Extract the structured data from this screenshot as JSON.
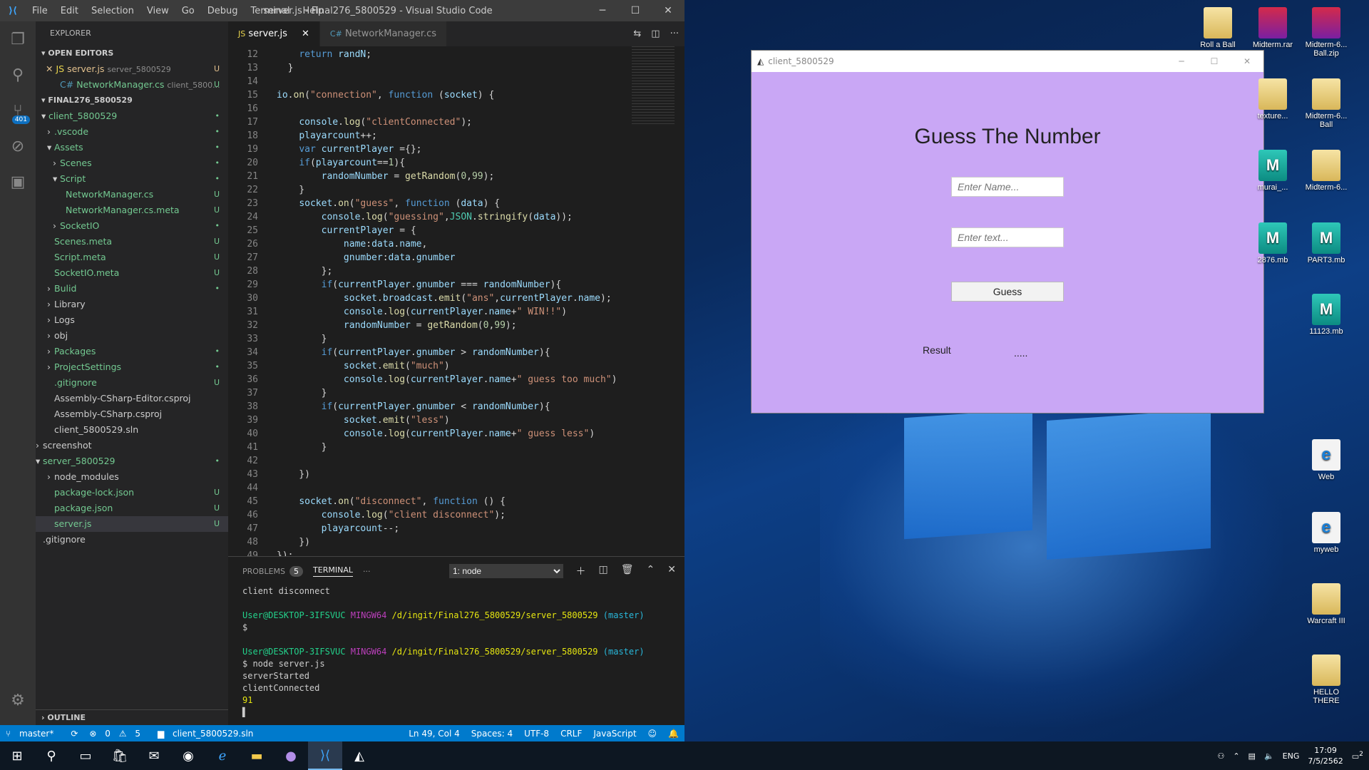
{
  "vscode": {
    "menu": [
      "File",
      "Edit",
      "Selection",
      "View",
      "Go",
      "Debug",
      "Terminal",
      "Help"
    ],
    "title": "server.js - Final276_5800529 - Visual Studio Code",
    "scm_badge": "401",
    "explorer_header": "EXPLORER",
    "open_editors_label": "OPEN EDITORS",
    "open_editors": [
      {
        "name": "server.js",
        "desc": "server_5800529",
        "status": "U",
        "icon": "JS"
      },
      {
        "name": "NetworkManager.cs",
        "desc": "client_5800...",
        "status": "U",
        "icon": "C#"
      }
    ],
    "workspace_label": "FINAL276_5800529",
    "tree": [
      {
        "name": "client_5800529",
        "status": "•"
      },
      {
        "name": ".vscode",
        "status": "•"
      },
      {
        "name": "Assets",
        "status": "•"
      },
      {
        "name": "Scenes",
        "status": "•"
      },
      {
        "name": "Script",
        "status": "•"
      },
      {
        "name": "NetworkManager.cs",
        "status": "U"
      },
      {
        "name": "NetworkManager.cs.meta",
        "status": "U"
      },
      {
        "name": "SocketIO",
        "status": "•"
      },
      {
        "name": "Scenes.meta",
        "status": "U"
      },
      {
        "name": "Script.meta",
        "status": "U"
      },
      {
        "name": "SocketIO.meta",
        "status": "U"
      },
      {
        "name": "Bulid",
        "status": "•"
      },
      {
        "name": "Library",
        "status": ""
      },
      {
        "name": "Logs",
        "status": ""
      },
      {
        "name": "obj",
        "status": ""
      },
      {
        "name": "Packages",
        "status": "•"
      },
      {
        "name": "ProjectSettings",
        "status": "•"
      },
      {
        "name": ".gitignore",
        "status": "U"
      },
      {
        "name": "Assembly-CSharp-Editor.csproj",
        "status": ""
      },
      {
        "name": "Assembly-CSharp.csproj",
        "status": ""
      },
      {
        "name": "client_5800529.sln",
        "status": ""
      },
      {
        "name": "screenshot",
        "status": ""
      },
      {
        "name": "server_5800529",
        "status": "•"
      },
      {
        "name": "node_modules",
        "status": ""
      },
      {
        "name": "package-lock.json",
        "status": "U"
      },
      {
        "name": "package.json",
        "status": "U"
      },
      {
        "name": "server.js",
        "status": "U"
      },
      {
        "name": ".gitignore",
        "status": ""
      }
    ],
    "outline_label": "OUTLINE",
    "tabs": [
      "server.js",
      "NetworkManager.cs"
    ],
    "code_lines": [
      "12",
      "13",
      "14",
      "15",
      "16",
      "17",
      "18",
      "19",
      "20",
      "21",
      "22",
      "23",
      "24",
      "25",
      "26",
      "27",
      "28",
      "29",
      "30",
      "31",
      "32",
      "33",
      "34",
      "35",
      "36",
      "37",
      "38",
      "39",
      "40",
      "41",
      "42",
      "43",
      "44",
      "45",
      "46",
      "47",
      "48",
      "49"
    ],
    "panel": {
      "problems_label": "PROBLEMS",
      "problems_count": "5",
      "terminal_label": "TERMINAL",
      "more": "···",
      "terminal_select": "1: node",
      "lines": [
        "client disconnect",
        "",
        "User@DESKTOP-3IFSVUC MINGW64 /d/ingit/Final276_5800529/server_5800529 (master)",
        "$",
        "",
        "User@DESKTOP-3IFSVUC MINGW64 /d/ingit/Final276_5800529/server_5800529 (master)",
        "$ node server.js",
        "serverStarted",
        "clientConnected",
        "91"
      ]
    },
    "status": {
      "branch": "master*",
      "errors": "0",
      "warnings": "5",
      "solution": "client_5800529.sln",
      "position": "Ln 49, Col 4",
      "spaces": "Spaces: 4",
      "encoding": "UTF-8",
      "eol": "CRLF",
      "language": "JavaScript"
    }
  },
  "client": {
    "window_title": "client_5800529",
    "heading": "Guess The Number",
    "name_placeholder": "Enter Name...",
    "text_placeholder": "Enter text...",
    "guess_button": "Guess",
    "result_label": "Result",
    "result_value": "....."
  },
  "desktop_icons": [
    {
      "label": "Roll a Ball",
      "kind": "folder"
    },
    {
      "label": "Midterm.rar",
      "kind": "rar"
    },
    {
      "label": "Midterm-6... Ball.zip",
      "kind": "rar"
    },
    {
      "label": "texture...",
      "kind": "folder"
    },
    {
      "label": "Midterm-6... Ball",
      "kind": "folder"
    },
    {
      "label": "murai_...",
      "kind": "mb"
    },
    {
      "label": "Midterm-6...",
      "kind": "folder"
    },
    {
      "label": "2876.mb",
      "kind": "mb"
    },
    {
      "label": "PART3.mb",
      "kind": "mb"
    },
    {
      "label": "11123.mb",
      "kind": "mb"
    },
    {
      "label": "Web",
      "kind": "ie"
    },
    {
      "label": "myweb",
      "kind": "ie"
    },
    {
      "label": "Warcraft III",
      "kind": "folder"
    },
    {
      "label": "HELLO THERE",
      "kind": "folder"
    }
  ],
  "taskbar": {
    "lang": "ENG",
    "time": "17:09",
    "date": "7/5/2562",
    "notif": "2"
  }
}
